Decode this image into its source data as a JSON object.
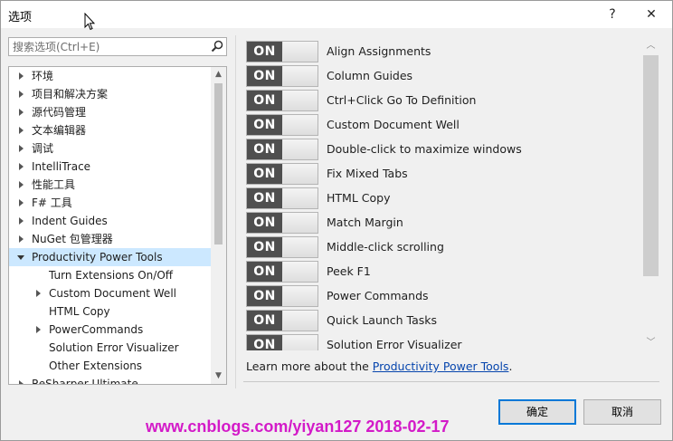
{
  "window": {
    "title": "选项",
    "help_label": "?",
    "close_label": "✕"
  },
  "search": {
    "placeholder": "搜索选项(Ctrl+E)",
    "icon": "search-icon"
  },
  "tree": {
    "items": [
      {
        "label": "环境",
        "expanded": false,
        "has_children": true,
        "level": 0
      },
      {
        "label": "项目和解决方案",
        "expanded": false,
        "has_children": true,
        "level": 0
      },
      {
        "label": "源代码管理",
        "expanded": false,
        "has_children": true,
        "level": 0
      },
      {
        "label": "文本编辑器",
        "expanded": false,
        "has_children": true,
        "level": 0
      },
      {
        "label": "调试",
        "expanded": false,
        "has_children": true,
        "level": 0
      },
      {
        "label": "IntelliTrace",
        "expanded": false,
        "has_children": true,
        "level": 0
      },
      {
        "label": "性能工具",
        "expanded": false,
        "has_children": true,
        "level": 0
      },
      {
        "label": "F# 工具",
        "expanded": false,
        "has_children": true,
        "level": 0
      },
      {
        "label": "Indent Guides",
        "expanded": false,
        "has_children": true,
        "level": 0
      },
      {
        "label": "NuGet 包管理器",
        "expanded": false,
        "has_children": true,
        "level": 0
      },
      {
        "label": "Productivity Power Tools",
        "expanded": true,
        "has_children": true,
        "level": 0,
        "selected": true
      },
      {
        "label": "Turn Extensions On/Off",
        "has_children": false,
        "level": 1
      },
      {
        "label": "Custom Document Well",
        "expanded": false,
        "has_children": true,
        "level": 1
      },
      {
        "label": "HTML Copy",
        "has_children": false,
        "level": 1
      },
      {
        "label": "PowerCommands",
        "expanded": false,
        "has_children": true,
        "level": 1
      },
      {
        "label": "Solution Error Visualizer",
        "has_children": false,
        "level": 1
      },
      {
        "label": "Other Extensions",
        "has_children": false,
        "level": 1
      },
      {
        "label": "ReSharper Ultimate",
        "expanded": false,
        "has_children": true,
        "level": 0
      }
    ]
  },
  "features": {
    "toggle_on_label": "ON",
    "items": [
      {
        "label": "Align Assignments",
        "state": "ON"
      },
      {
        "label": "Column Guides",
        "state": "ON"
      },
      {
        "label": "Ctrl+Click Go To Definition",
        "state": "ON"
      },
      {
        "label": "Custom Document Well",
        "state": "ON"
      },
      {
        "label": "Double-click to maximize windows",
        "state": "ON"
      },
      {
        "label": "Fix Mixed Tabs",
        "state": "ON"
      },
      {
        "label": "HTML Copy",
        "state": "ON"
      },
      {
        "label": "Match Margin",
        "state": "ON"
      },
      {
        "label": "Middle-click scrolling",
        "state": "ON"
      },
      {
        "label": "Peek F1",
        "state": "ON"
      },
      {
        "label": "Power Commands",
        "state": "ON"
      },
      {
        "label": "Quick Launch Tasks",
        "state": "ON"
      },
      {
        "label": "Solution Error Visualizer",
        "state": "ON"
      }
    ]
  },
  "footer": {
    "learn_prefix": "Learn more about the ",
    "learn_link": "Productivity Power Tools",
    "learn_suffix": ".",
    "ok_label": "确定",
    "cancel_label": "取消"
  },
  "watermark": "www.cnblogs.com/yiyan127 2018-02-17",
  "colors": {
    "toggle_on": "#4f4f4f",
    "selection": "#cce8ff",
    "link": "#0645ad",
    "watermark": "#d31ac8",
    "primary_border": "#0078d7"
  }
}
